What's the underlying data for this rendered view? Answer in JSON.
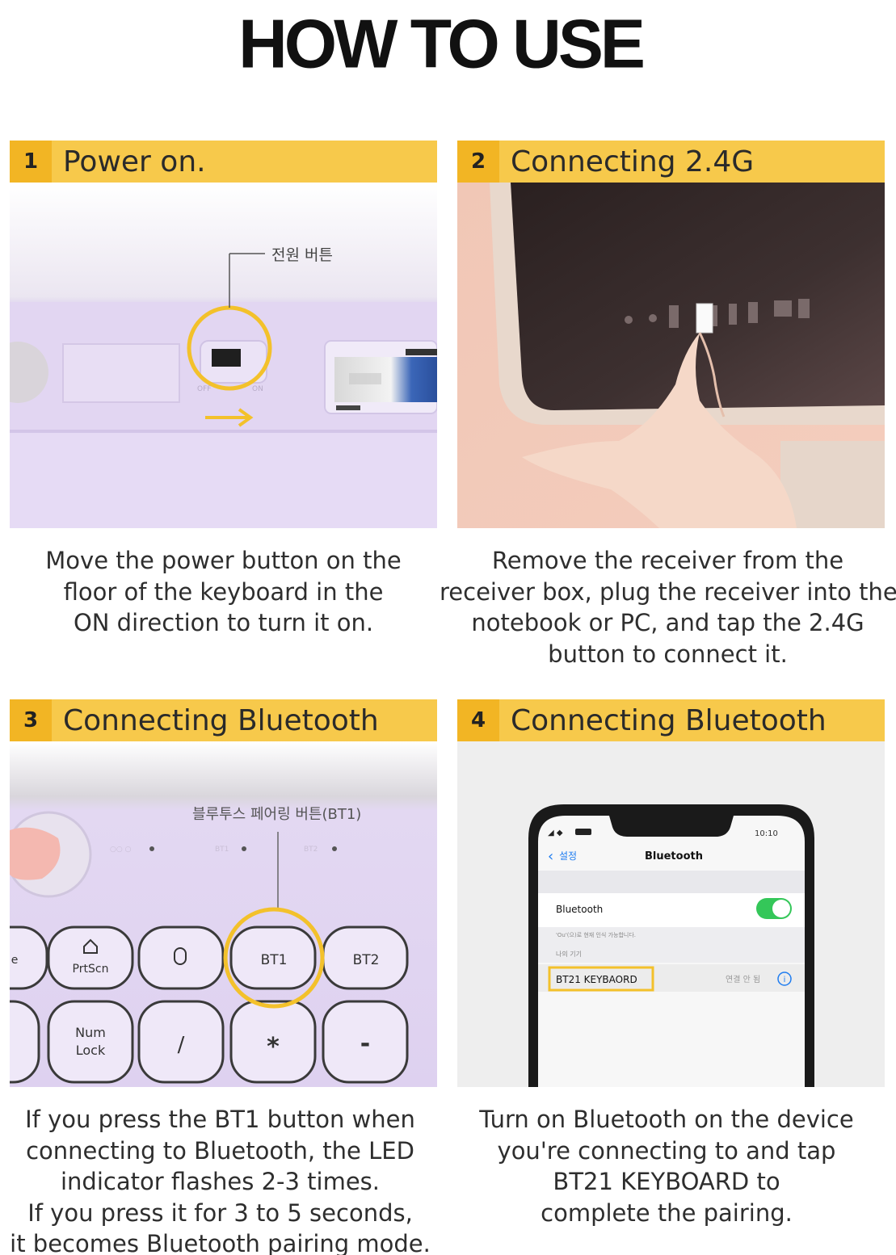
{
  "title": "HOW TO USE",
  "steps": [
    {
      "number": "1",
      "title": "Power on.",
      "photo_label": "전원 버튼",
      "caption": [
        "Move the power button on the",
        "floor of the keyboard in the",
        "ON direction to turn it on."
      ]
    },
    {
      "number": "2",
      "title": "Connecting 2.4G",
      "caption": [
        "Remove the receiver from the",
        "receiver box, plug the receiver into the",
        "notebook or PC, and tap the 2.4G",
        "button to connect it."
      ]
    },
    {
      "number": "3",
      "title": "Connecting Bluetooth",
      "photo_label": "블루투스 페어링 버튼(BT1)",
      "keys": {
        "prtscn": "PrtScn",
        "bt1": "BT1",
        "bt2": "BT2",
        "num": "Num",
        "lock": "Lock",
        "slash": "/",
        "star": "*",
        "minus": "-",
        "e": "e"
      },
      "caption": [
        "If you press the BT1 button when",
        "connecting to Bluetooth, the LED",
        "indicator flashes 2-3 times.",
        "If you press it for 3 to 5 seconds,",
        "it becomes Bluetooth pairing mode."
      ]
    },
    {
      "number": "4",
      "title": "Connecting Bluetooth",
      "phone": {
        "time": "10:10",
        "back": "설정",
        "screen_title": "Bluetooth",
        "toggle_label": "Bluetooth",
        "toggle_on": true,
        "discoverable_note": "'Ou'(으)로 현재 인식 가능합니다.",
        "my_devices": "나의 기기",
        "device_name": "BT21 KEYBAORD",
        "device_status": "연결 안 됨"
      },
      "caption": [
        "Turn on Bluetooth on the device",
        "you're connecting to and tap",
        "BT21 KEYBOARD to",
        "complete the pairing."
      ]
    }
  ]
}
